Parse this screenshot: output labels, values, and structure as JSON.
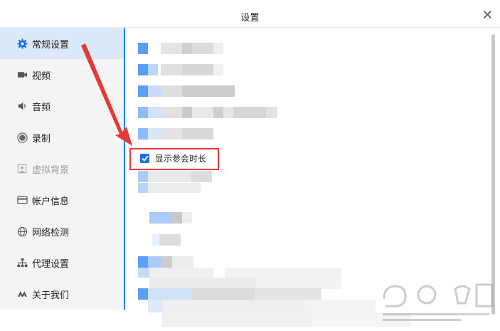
{
  "window": {
    "title": "设置"
  },
  "sidebar": {
    "items": [
      {
        "label": "常规设置",
        "icon": "gear-icon",
        "active": true
      },
      {
        "label": "视频",
        "icon": "camera-icon"
      },
      {
        "label": "音频",
        "icon": "speaker-icon"
      },
      {
        "label": "录制",
        "icon": "record-icon"
      },
      {
        "label": "虚拟背景",
        "icon": "portrait-icon",
        "disabled": true
      },
      {
        "label": "帐户信息",
        "icon": "card-icon"
      },
      {
        "label": "网络检测",
        "icon": "globe-icon"
      },
      {
        "label": "代理设置",
        "icon": "network-icon"
      },
      {
        "label": "关于我们",
        "icon": "logo-icon"
      }
    ]
  },
  "content": {
    "checkbox_label": "显示参会时长",
    "checkbox_checked": true
  },
  "colors": {
    "accent": "#1a82ff",
    "highlight": "#e53935",
    "checkbox": "#1a6df0"
  }
}
